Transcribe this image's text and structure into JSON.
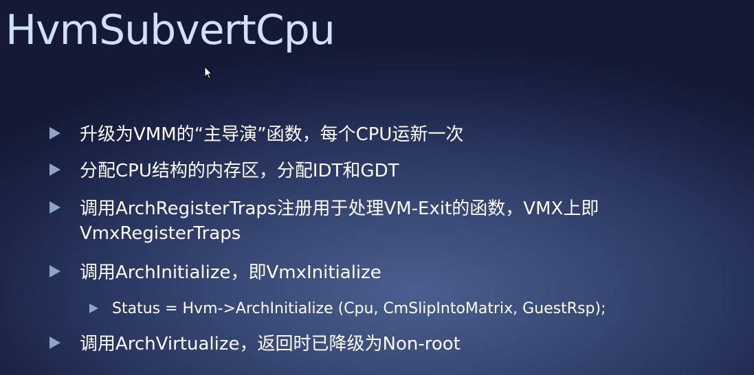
{
  "slide": {
    "title": "HvmSubvertCpu",
    "bullets": [
      "升级为VMM的“主导演”函数，每个CPU运新一次",
      "分配CPU结构的内存区，分配IDT和GDT",
      "调用ArchRegisterTraps注册用于处理VM-Exit的函数，VMX上即VmxRegisterTraps",
      "调用ArchInitialize，即VmxInitialize",
      "调用ArchVirtualize，返回时已降级为Non-root"
    ],
    "sub_bullet": "Status = Hvm->ArchInitialize (Cpu, CmSlipIntoMatrix, GuestRsp);"
  },
  "colors": {
    "background_dark": "#141a36",
    "background_light": "#4a5f8e",
    "title": "#cfe0f7",
    "bullet_arrow": "#8ea3c9",
    "text": "#ffffff"
  },
  "icons": {
    "cursor": "mouse-pointer-icon",
    "bullet": "triangle-right-icon"
  }
}
